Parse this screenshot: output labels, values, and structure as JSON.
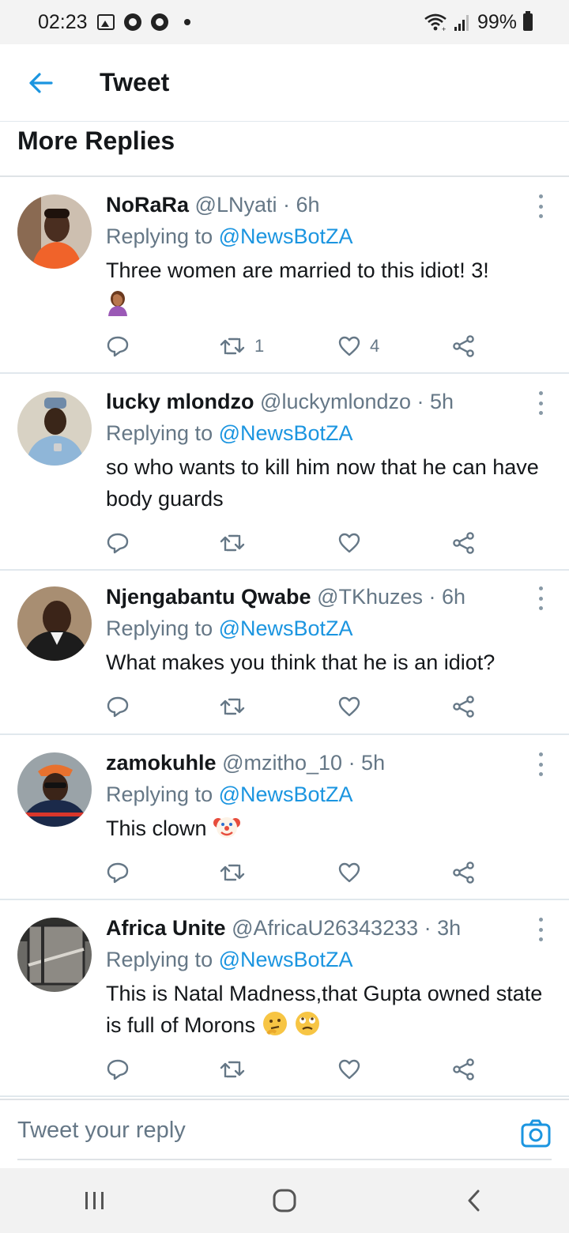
{
  "status_bar": {
    "time": "02:23",
    "battery": "99%",
    "icons": [
      "image-icon",
      "chrome-icon",
      "chrome-icon",
      "dot-icon",
      "wifi-icon",
      "signal-icon",
      "battery-icon"
    ]
  },
  "header": {
    "title": "Tweet",
    "back_icon": "arrow-left-icon"
  },
  "section": {
    "title": "More Replies"
  },
  "colors": {
    "accent": "#1b95e0",
    "text": "#14171a",
    "muted": "#657786",
    "divider": "#e1e8ed"
  },
  "tweets": [
    {
      "name": "NoRaRa",
      "handle": "@LNyati",
      "time": "· 6h",
      "replying_prefix": "Replying to",
      "replying_to": "@NewsBotZA",
      "text": "Three women are married to this idiot! 3!",
      "emoji": [
        "facepalm-emoji"
      ],
      "retweets": "1",
      "likes": "4"
    },
    {
      "name": "lucky mlondzo",
      "handle": "@luckymlondzo",
      "time": "· 5h",
      "replying_prefix": "Replying to",
      "replying_to": "@NewsBotZA",
      "text": "so who wants to kill him now that he can have body guards",
      "retweets": "",
      "likes": ""
    },
    {
      "name": "Njengabantu Qwabe",
      "handle": "@TKhuzes",
      "time": "· 6h",
      "replying_prefix": "Replying to",
      "replying_to": "@NewsBotZA",
      "text": "What makes you think that he is an idiot?",
      "retweets": "",
      "likes": ""
    },
    {
      "name": "zamokuhle",
      "handle": "@mzitho_10",
      "time": "· 5h",
      "replying_prefix": "Replying to",
      "replying_to": "@NewsBotZA",
      "text": "This clown",
      "emoji": [
        "clown-emoji"
      ],
      "retweets": "",
      "likes": ""
    },
    {
      "name": "Africa Unite",
      "handle": "@AfricaU26343233",
      "time": "· 3h",
      "replying_prefix": "Replying to",
      "replying_to": "@NewsBotZA",
      "text": "This is Natal Madness,that Gupta owned state is full of Morons",
      "emoji": [
        "thinking-emoji",
        "eye-roll-emoji"
      ],
      "retweets": "",
      "likes": ""
    }
  ],
  "reply_bar": {
    "placeholder": "Tweet your reply",
    "camera_icon": "camera-icon"
  },
  "nav_bar": {
    "icons": [
      "recent-apps-icon",
      "home-icon",
      "back-icon"
    ]
  }
}
